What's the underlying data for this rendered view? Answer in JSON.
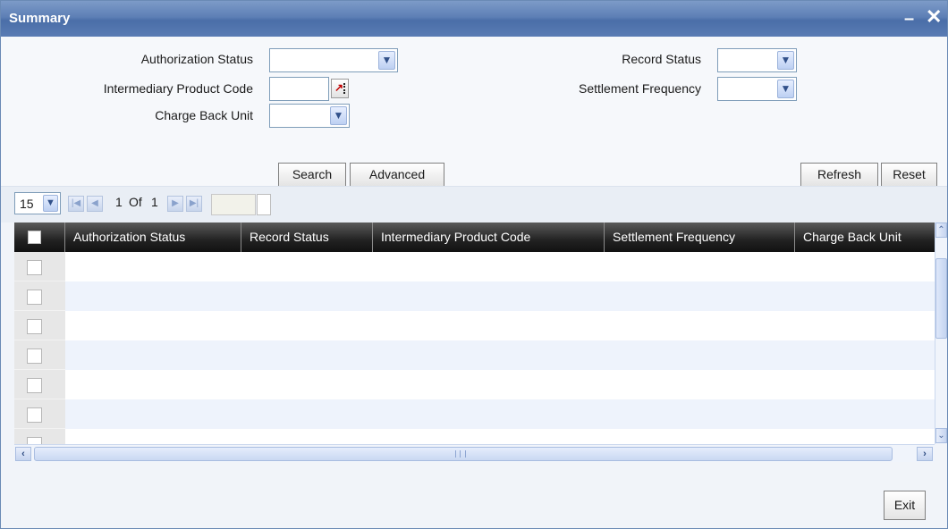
{
  "window": {
    "title": "Summary"
  },
  "form": {
    "authorization_status": {
      "label": "Authorization Status",
      "value": ""
    },
    "record_status": {
      "label": "Record Status",
      "value": ""
    },
    "intermediary_product_code": {
      "label": "Intermediary Product Code",
      "value": ""
    },
    "settlement_frequency": {
      "label": "Settlement Frequency",
      "value": ""
    },
    "charge_back_unit": {
      "label": "Charge Back Unit",
      "value": ""
    }
  },
  "buttons": {
    "search": "Search",
    "advanced": "Advanced",
    "refresh": "Refresh",
    "reset": "Reset",
    "exit": "Exit"
  },
  "pager": {
    "page_size": "15",
    "current_page": "1",
    "of_label": "Of",
    "total_pages": "1"
  },
  "grid": {
    "columns": [
      "Authorization Status",
      "Record Status",
      "Intermediary Product Code",
      "Settlement Frequency",
      "Charge Back Unit"
    ],
    "row_count": 7,
    "row_colors": [
      "#ffffff",
      "#eef3fc"
    ]
  },
  "icons": {
    "minimize": "minimize-icon",
    "close": "close-icon",
    "lov": "lov-icon",
    "dropdown": "chevron-down-icon"
  },
  "colors": {
    "title_bar": "#5d7fb5",
    "grid_header": "#222222"
  }
}
